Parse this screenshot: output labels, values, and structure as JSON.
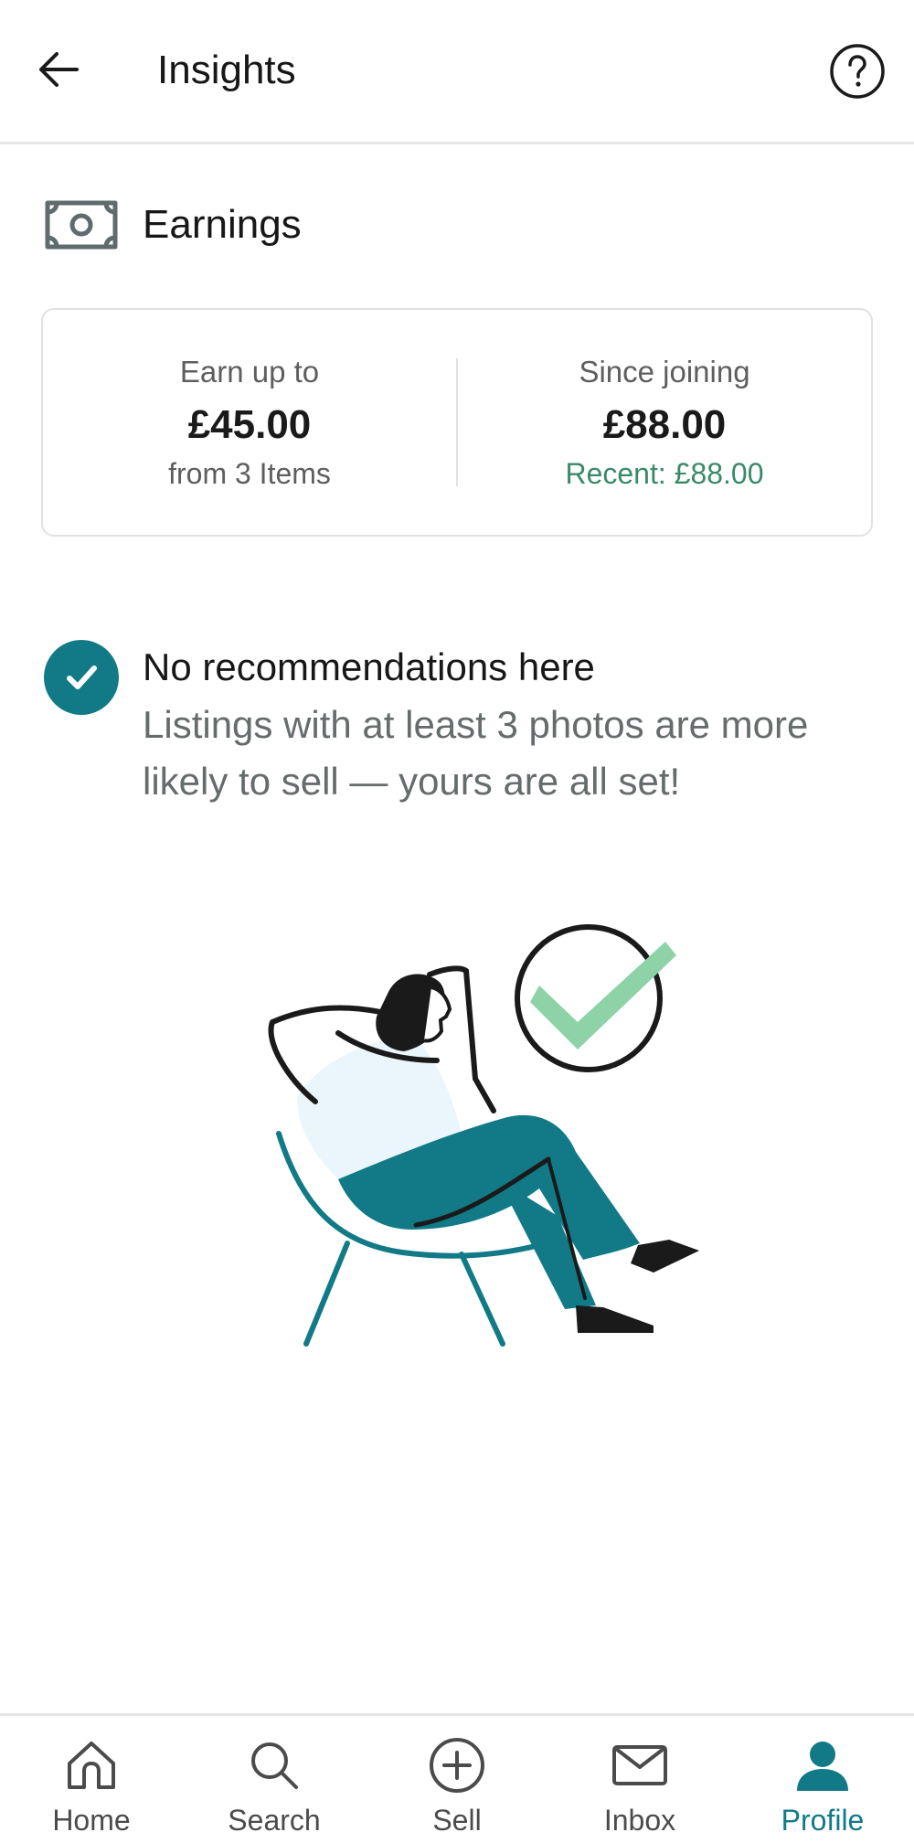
{
  "header": {
    "title": "Insights",
    "back_icon": "arrow-left-icon",
    "help_icon": "question-circle-icon"
  },
  "earnings": {
    "section_title": "Earnings",
    "icon": "banknote-icon",
    "potential": {
      "label": "Earn up to",
      "value": "£45.00",
      "sub": "from 3 Items"
    },
    "since_joining": {
      "label": "Since joining",
      "value": "£88.00",
      "sub": "Recent: £88.00"
    }
  },
  "recommendation": {
    "title": "No recommendations here",
    "body": "Listings with at least 3 photos are more likely to sell — yours are all set!",
    "icon": "check-circle-icon"
  },
  "illustration": {
    "name": "relaxing-person-illustration"
  },
  "bottom_nav": {
    "items": [
      {
        "label": "Home",
        "icon": "home-icon"
      },
      {
        "label": "Search",
        "icon": "search-icon"
      },
      {
        "label": "Sell",
        "icon": "plus-circle-icon"
      },
      {
        "label": "Inbox",
        "icon": "mail-icon"
      },
      {
        "label": "Profile",
        "icon": "profile-icon",
        "active": true
      }
    ]
  },
  "colors": {
    "accent": "#127a87",
    "positive": "#3a8a6a",
    "check_light": "#8ed3a7",
    "text_primary": "#171717",
    "text_secondary": "#5e5e5e"
  }
}
